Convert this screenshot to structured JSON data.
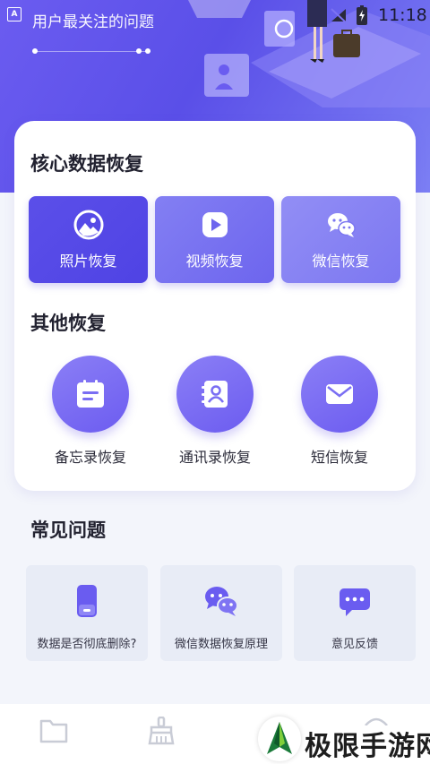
{
  "status_bar": {
    "time": "11:18",
    "app_icon_letter": "A"
  },
  "header": {
    "title": "用户最关注的问题"
  },
  "core": {
    "title": "核心数据恢复",
    "items": [
      {
        "label": "照片恢复",
        "icon": "photo-icon",
        "color_start": "#5b4fe9",
        "color_end": "#5346e6"
      },
      {
        "label": "视频恢复",
        "icon": "video-play-icon",
        "color_start": "#7d79f1",
        "color_end": "#6d64ee"
      },
      {
        "label": "微信恢复",
        "icon": "wechat-icon",
        "color_start": "#8a86f3",
        "color_end": "#7b76f1"
      }
    ]
  },
  "other": {
    "title": "其他恢复",
    "items": [
      {
        "label": "备忘录恢复",
        "icon": "memo-icon"
      },
      {
        "label": "通讯录恢复",
        "icon": "contacts-icon"
      },
      {
        "label": "短信恢复",
        "icon": "message-icon"
      }
    ]
  },
  "faq": {
    "title": "常见问题",
    "items": [
      {
        "label": "数据是否彻底删除?",
        "icon": "phone-icon"
      },
      {
        "label": "微信数据恢复原理",
        "icon": "wechat-icon"
      },
      {
        "label": "意见反馈",
        "icon": "feedback-chat-icon"
      }
    ]
  },
  "watermark": {
    "text": "极限手游网"
  },
  "colors": {
    "accent": "#6a5cf0",
    "icon_gray": "#c9ccd6"
  }
}
